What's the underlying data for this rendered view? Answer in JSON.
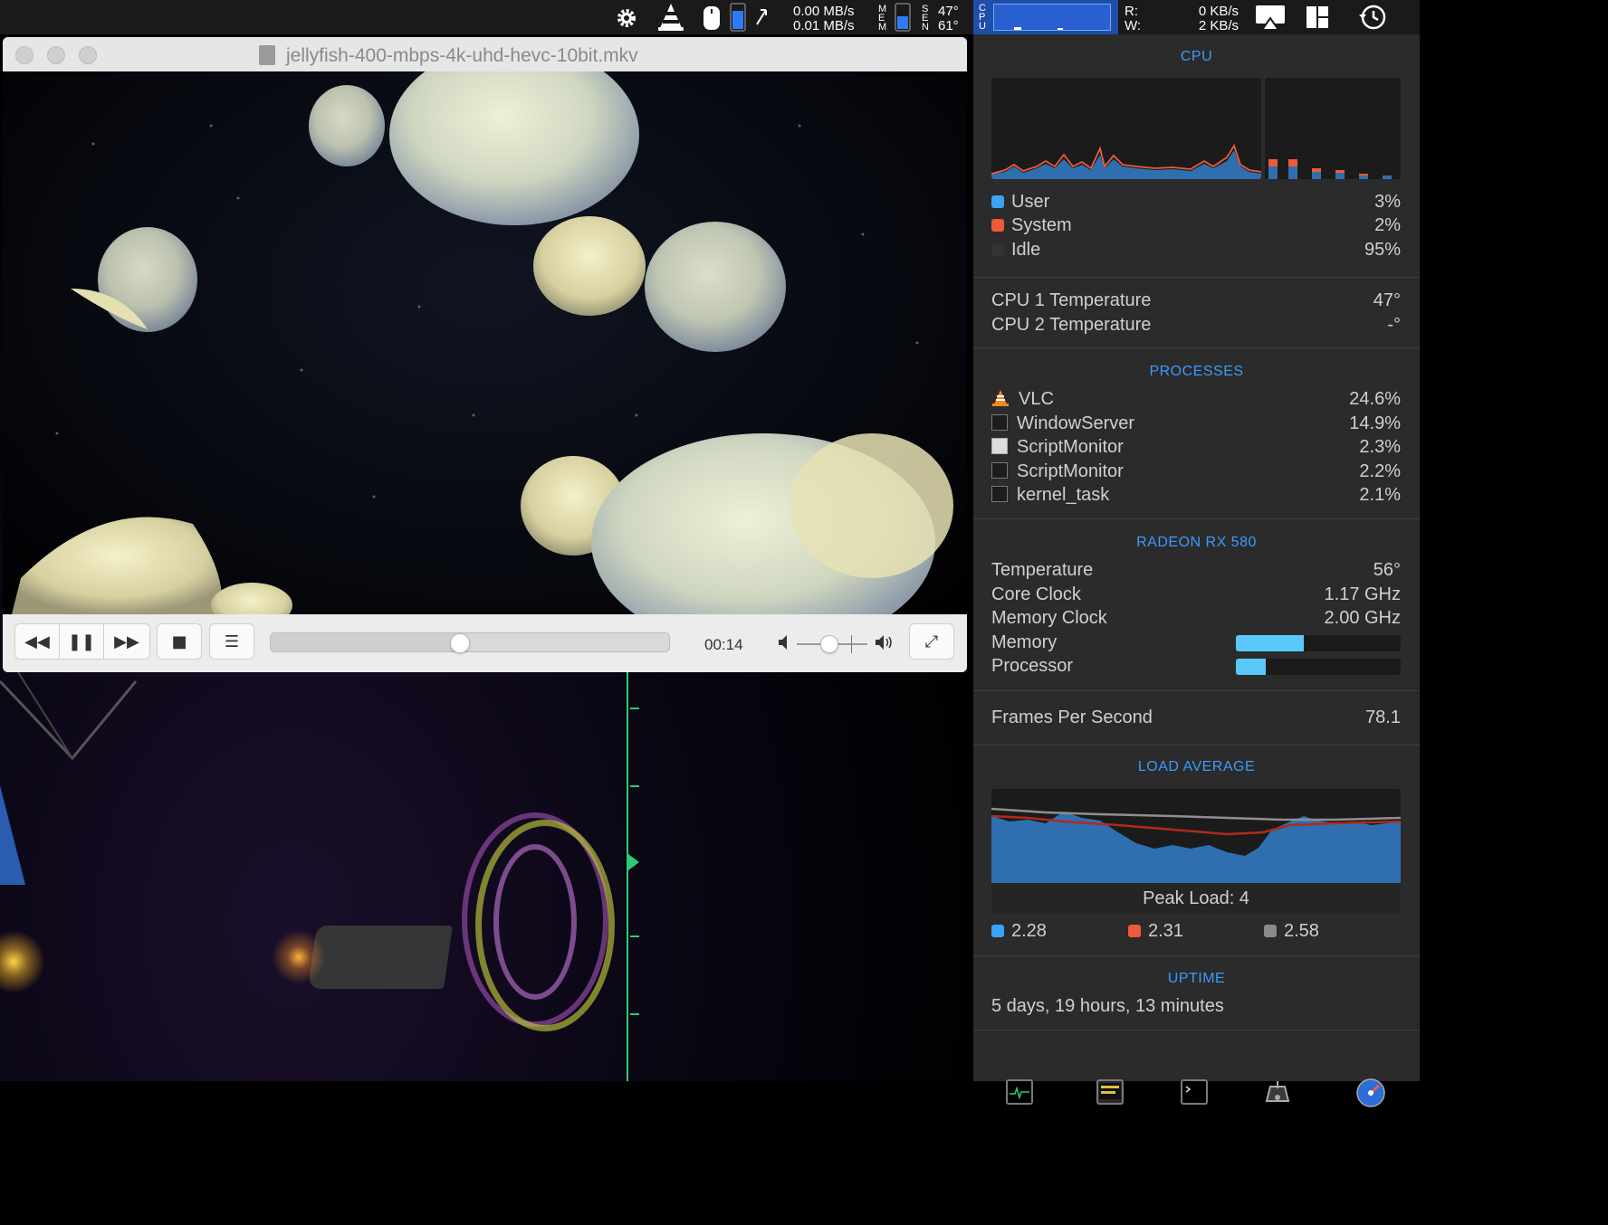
{
  "menubar": {
    "net_up": "0.00 MB/s",
    "net_down": "0.01 MB/s",
    "mem_label": "MEM",
    "sensor_label": "SEN",
    "sensor_temp1": "47°",
    "sensor_temp2": "61°",
    "cpu_label": "CPU",
    "disk_read_label": "R:",
    "disk_write_label": "W:",
    "disk_read": "0 KB/s",
    "disk_write": "2 KB/s"
  },
  "vlc": {
    "title": "jellyfish-400-mbps-4k-uhd-hevc-10bit.mkv",
    "time": "00:14",
    "seek_progress": 0.47,
    "volume_level": 0.45,
    "buttons": {
      "rewind": "◀◀",
      "pause": "❚❚",
      "forward": "▶▶",
      "stop": "■",
      "playlist": "☰",
      "fullscreen": "⤢"
    }
  },
  "panel": {
    "cpu": {
      "title": "CPU",
      "rows": [
        {
          "label": "User",
          "value": "3%",
          "color": "#3aa3f5"
        },
        {
          "label": "System",
          "value": "2%",
          "color": "#f05a3a"
        },
        {
          "label": "Idle",
          "value": "95%",
          "color": "#333333"
        }
      ]
    },
    "temps": [
      {
        "label": "CPU 1 Temperature",
        "value": "47°"
      },
      {
        "label": "CPU 2 Temperature",
        "value": "-°"
      }
    ],
    "processes": {
      "title": "PROCESSES",
      "rows": [
        {
          "name": "VLC",
          "value": "24.6%",
          "icon": "vlc-cone-icon"
        },
        {
          "name": "WindowServer",
          "value": "14.9%",
          "icon": "terminal-icon"
        },
        {
          "name": "ScriptMonitor",
          "value": "2.3%",
          "icon": "script-icon"
        },
        {
          "name": "ScriptMonitor",
          "value": "2.2%",
          "icon": "terminal-icon"
        },
        {
          "name": "kernel_task",
          "value": "2.1%",
          "icon": "terminal-icon"
        }
      ]
    },
    "gpu": {
      "title": "RADEON RX 580",
      "rows": [
        {
          "label": "Temperature",
          "value": "56°"
        },
        {
          "label": "Core Clock",
          "value": "1.17 GHz"
        },
        {
          "label": "Memory Clock",
          "value": "2.00 GHz"
        }
      ],
      "memory_label": "Memory",
      "memory_fraction": 0.41,
      "processor_label": "Processor",
      "processor_fraction": 0.18
    },
    "fps": {
      "label": "Frames Per Second",
      "value": "78.1"
    },
    "load": {
      "title": "LOAD AVERAGE",
      "peak": "Peak Load: 4",
      "values": [
        {
          "value": "2.28",
          "color": "#3aa3f5"
        },
        {
          "value": "2.31",
          "color": "#f05a3a"
        },
        {
          "value": "2.58",
          "color": "#8a8a8a"
        }
      ]
    },
    "uptime": {
      "title": "UPTIME",
      "value": "5 days, 19 hours, 13 minutes"
    },
    "accent": "#3b9bff"
  }
}
